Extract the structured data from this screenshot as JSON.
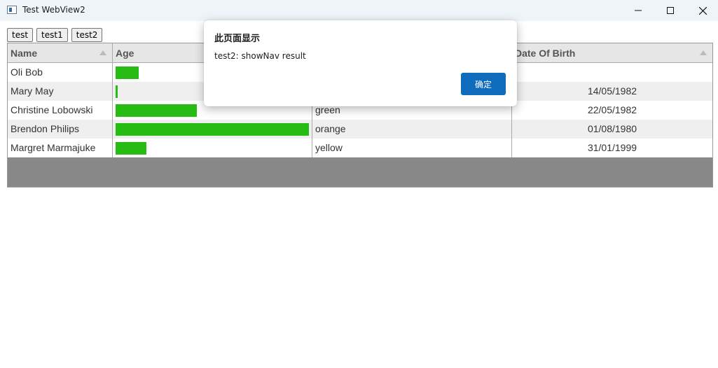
{
  "window": {
    "title": "Test WebView2",
    "icon": "app-window-icon",
    "controls": [
      "minimize-icon",
      "maximize-icon",
      "close-icon"
    ]
  },
  "toolbar": {
    "buttons": [
      "test",
      "test1",
      "test2"
    ]
  },
  "table": {
    "columns": [
      "Name",
      "Age",
      "Date Of Birth"
    ],
    "bar_color": "#26bc14",
    "rows": [
      {
        "name": "Oli Bob",
        "age_fill": 0.12,
        "color": "",
        "dob": ""
      },
      {
        "name": "Mary May",
        "age_fill": 0.01,
        "color": "",
        "dob": "14/05/1982"
      },
      {
        "name": "Christine Lobowski",
        "age_fill": 0.42,
        "color": "green",
        "dob": "22/05/1982"
      },
      {
        "name": "Brendon Philips",
        "age_fill": 1.0,
        "color": "orange",
        "dob": "01/08/1980"
      },
      {
        "name": "Margret Marmajuke",
        "age_fill": 0.16,
        "color": "yellow",
        "dob": "31/01/1999"
      }
    ]
  },
  "dialog": {
    "title": "此页面显示",
    "message": "test2: showNav result",
    "ok_label": "确定",
    "ok_color": "#0f6cbd"
  }
}
